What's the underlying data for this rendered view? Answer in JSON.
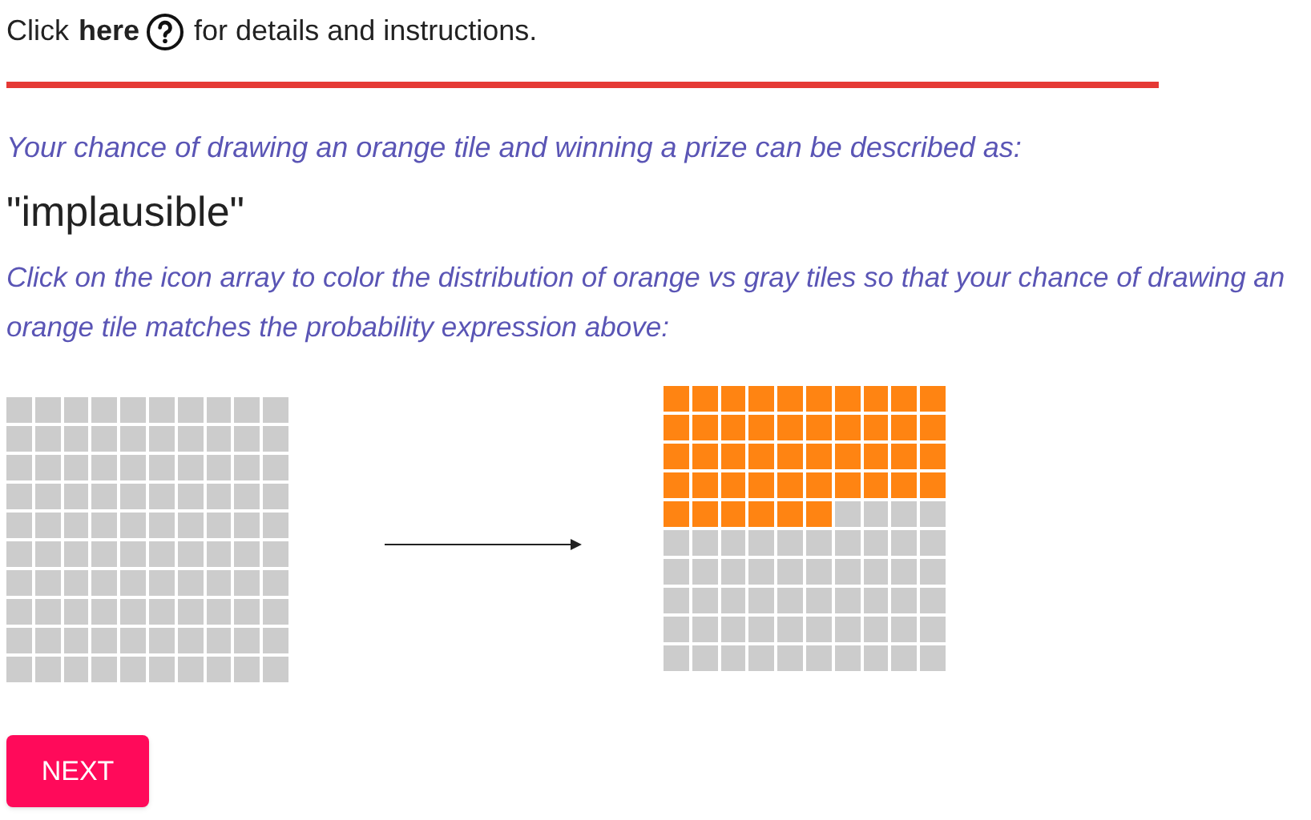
{
  "help_line": {
    "before": "Click",
    "link": "here",
    "after": "for details and instructions."
  },
  "prompt": "Your chance of drawing an orange tile and winning a prize can be described as:",
  "expression": "\"implausible\"",
  "instruction": "Click on the icon array to color the distribution of orange vs gray tiles so that your chance of drawing an orange tile matches the probability expression above:",
  "grids": [
    {
      "tiles": [
        {
          "filled": false
        },
        {
          "filled": false
        },
        {
          "filled": false
        },
        {
          "filled": false
        },
        {
          "filled": false
        },
        {
          "filled": false
        },
        {
          "filled": false
        },
        {
          "filled": false
        },
        {
          "filled": false
        },
        {
          "filled": false
        },
        {
          "filled": false
        },
        {
          "filled": false
        },
        {
          "filled": false
        },
        {
          "filled": false
        },
        {
          "filled": false
        },
        {
          "filled": false
        },
        {
          "filled": false
        },
        {
          "filled": false
        },
        {
          "filled": false
        },
        {
          "filled": false
        },
        {
          "filled": false
        },
        {
          "filled": false
        },
        {
          "filled": false
        },
        {
          "filled": false
        },
        {
          "filled": false
        },
        {
          "filled": false
        },
        {
          "filled": false
        },
        {
          "filled": false
        },
        {
          "filled": false
        },
        {
          "filled": false
        },
        {
          "filled": false
        },
        {
          "filled": false
        },
        {
          "filled": false
        },
        {
          "filled": false
        },
        {
          "filled": false
        },
        {
          "filled": false
        },
        {
          "filled": false
        },
        {
          "filled": false
        },
        {
          "filled": false
        },
        {
          "filled": false
        },
        {
          "filled": false
        },
        {
          "filled": false
        },
        {
          "filled": false
        },
        {
          "filled": false
        },
        {
          "filled": false
        },
        {
          "filled": false
        },
        {
          "filled": false
        },
        {
          "filled": false
        },
        {
          "filled": false
        },
        {
          "filled": false
        },
        {
          "filled": false
        },
        {
          "filled": false
        },
        {
          "filled": false
        },
        {
          "filled": false
        },
        {
          "filled": false
        },
        {
          "filled": false
        },
        {
          "filled": false
        },
        {
          "filled": false
        },
        {
          "filled": false
        },
        {
          "filled": false
        },
        {
          "filled": false
        },
        {
          "filled": false
        },
        {
          "filled": false
        },
        {
          "filled": false
        },
        {
          "filled": false
        },
        {
          "filled": false
        },
        {
          "filled": false
        },
        {
          "filled": false
        },
        {
          "filled": false
        },
        {
          "filled": false
        },
        {
          "filled": false
        },
        {
          "filled": false
        },
        {
          "filled": false
        },
        {
          "filled": false
        },
        {
          "filled": false
        },
        {
          "filled": false
        },
        {
          "filled": false
        },
        {
          "filled": false
        },
        {
          "filled": false
        },
        {
          "filled": false
        },
        {
          "filled": false
        },
        {
          "filled": false
        },
        {
          "filled": false
        },
        {
          "filled": false
        },
        {
          "filled": false
        },
        {
          "filled": false
        },
        {
          "filled": false
        },
        {
          "filled": false
        },
        {
          "filled": false
        },
        {
          "filled": false
        },
        {
          "filled": false
        },
        {
          "filled": false
        },
        {
          "filled": false
        },
        {
          "filled": false
        },
        {
          "filled": false
        },
        {
          "filled": false
        },
        {
          "filled": false
        },
        {
          "filled": false
        },
        {
          "filled": false
        },
        {
          "filled": false
        }
      ]
    },
    {
      "tiles": [
        {
          "filled": true
        },
        {
          "filled": true
        },
        {
          "filled": true
        },
        {
          "filled": true
        },
        {
          "filled": true
        },
        {
          "filled": true
        },
        {
          "filled": true
        },
        {
          "filled": true
        },
        {
          "filled": true
        },
        {
          "filled": true
        },
        {
          "filled": true
        },
        {
          "filled": true
        },
        {
          "filled": true
        },
        {
          "filled": true
        },
        {
          "filled": true
        },
        {
          "filled": true
        },
        {
          "filled": true
        },
        {
          "filled": true
        },
        {
          "filled": true
        },
        {
          "filled": true
        },
        {
          "filled": true
        },
        {
          "filled": true
        },
        {
          "filled": true
        },
        {
          "filled": true
        },
        {
          "filled": true
        },
        {
          "filled": true
        },
        {
          "filled": true
        },
        {
          "filled": true
        },
        {
          "filled": true
        },
        {
          "filled": true
        },
        {
          "filled": true
        },
        {
          "filled": true
        },
        {
          "filled": true
        },
        {
          "filled": true
        },
        {
          "filled": true
        },
        {
          "filled": true
        },
        {
          "filled": true
        },
        {
          "filled": true
        },
        {
          "filled": true
        },
        {
          "filled": true
        },
        {
          "filled": true
        },
        {
          "filled": true
        },
        {
          "filled": true
        },
        {
          "filled": true
        },
        {
          "filled": true
        },
        {
          "filled": true
        },
        {
          "filled": false
        },
        {
          "filled": false
        },
        {
          "filled": false
        },
        {
          "filled": false
        },
        {
          "filled": false
        },
        {
          "filled": false
        },
        {
          "filled": false
        },
        {
          "filled": false
        },
        {
          "filled": false
        },
        {
          "filled": false
        },
        {
          "filled": false
        },
        {
          "filled": false
        },
        {
          "filled": false
        },
        {
          "filled": false
        },
        {
          "filled": false
        },
        {
          "filled": false
        },
        {
          "filled": false
        },
        {
          "filled": false
        },
        {
          "filled": false
        },
        {
          "filled": false
        },
        {
          "filled": false
        },
        {
          "filled": false
        },
        {
          "filled": false
        },
        {
          "filled": false
        },
        {
          "filled": false
        },
        {
          "filled": false
        },
        {
          "filled": false
        },
        {
          "filled": false
        },
        {
          "filled": false
        },
        {
          "filled": false
        },
        {
          "filled": false
        },
        {
          "filled": false
        },
        {
          "filled": false
        },
        {
          "filled": false
        },
        {
          "filled": false
        },
        {
          "filled": false
        },
        {
          "filled": false
        },
        {
          "filled": false
        },
        {
          "filled": false
        },
        {
          "filled": false
        },
        {
          "filled": false
        },
        {
          "filled": false
        },
        {
          "filled": false
        },
        {
          "filled": false
        },
        {
          "filled": false
        },
        {
          "filled": false
        },
        {
          "filled": false
        },
        {
          "filled": false
        },
        {
          "filled": false
        },
        {
          "filled": false
        },
        {
          "filled": false
        },
        {
          "filled": false
        },
        {
          "filled": false
        },
        {
          "filled": false
        }
      ]
    }
  ],
  "next_button": "NEXT"
}
